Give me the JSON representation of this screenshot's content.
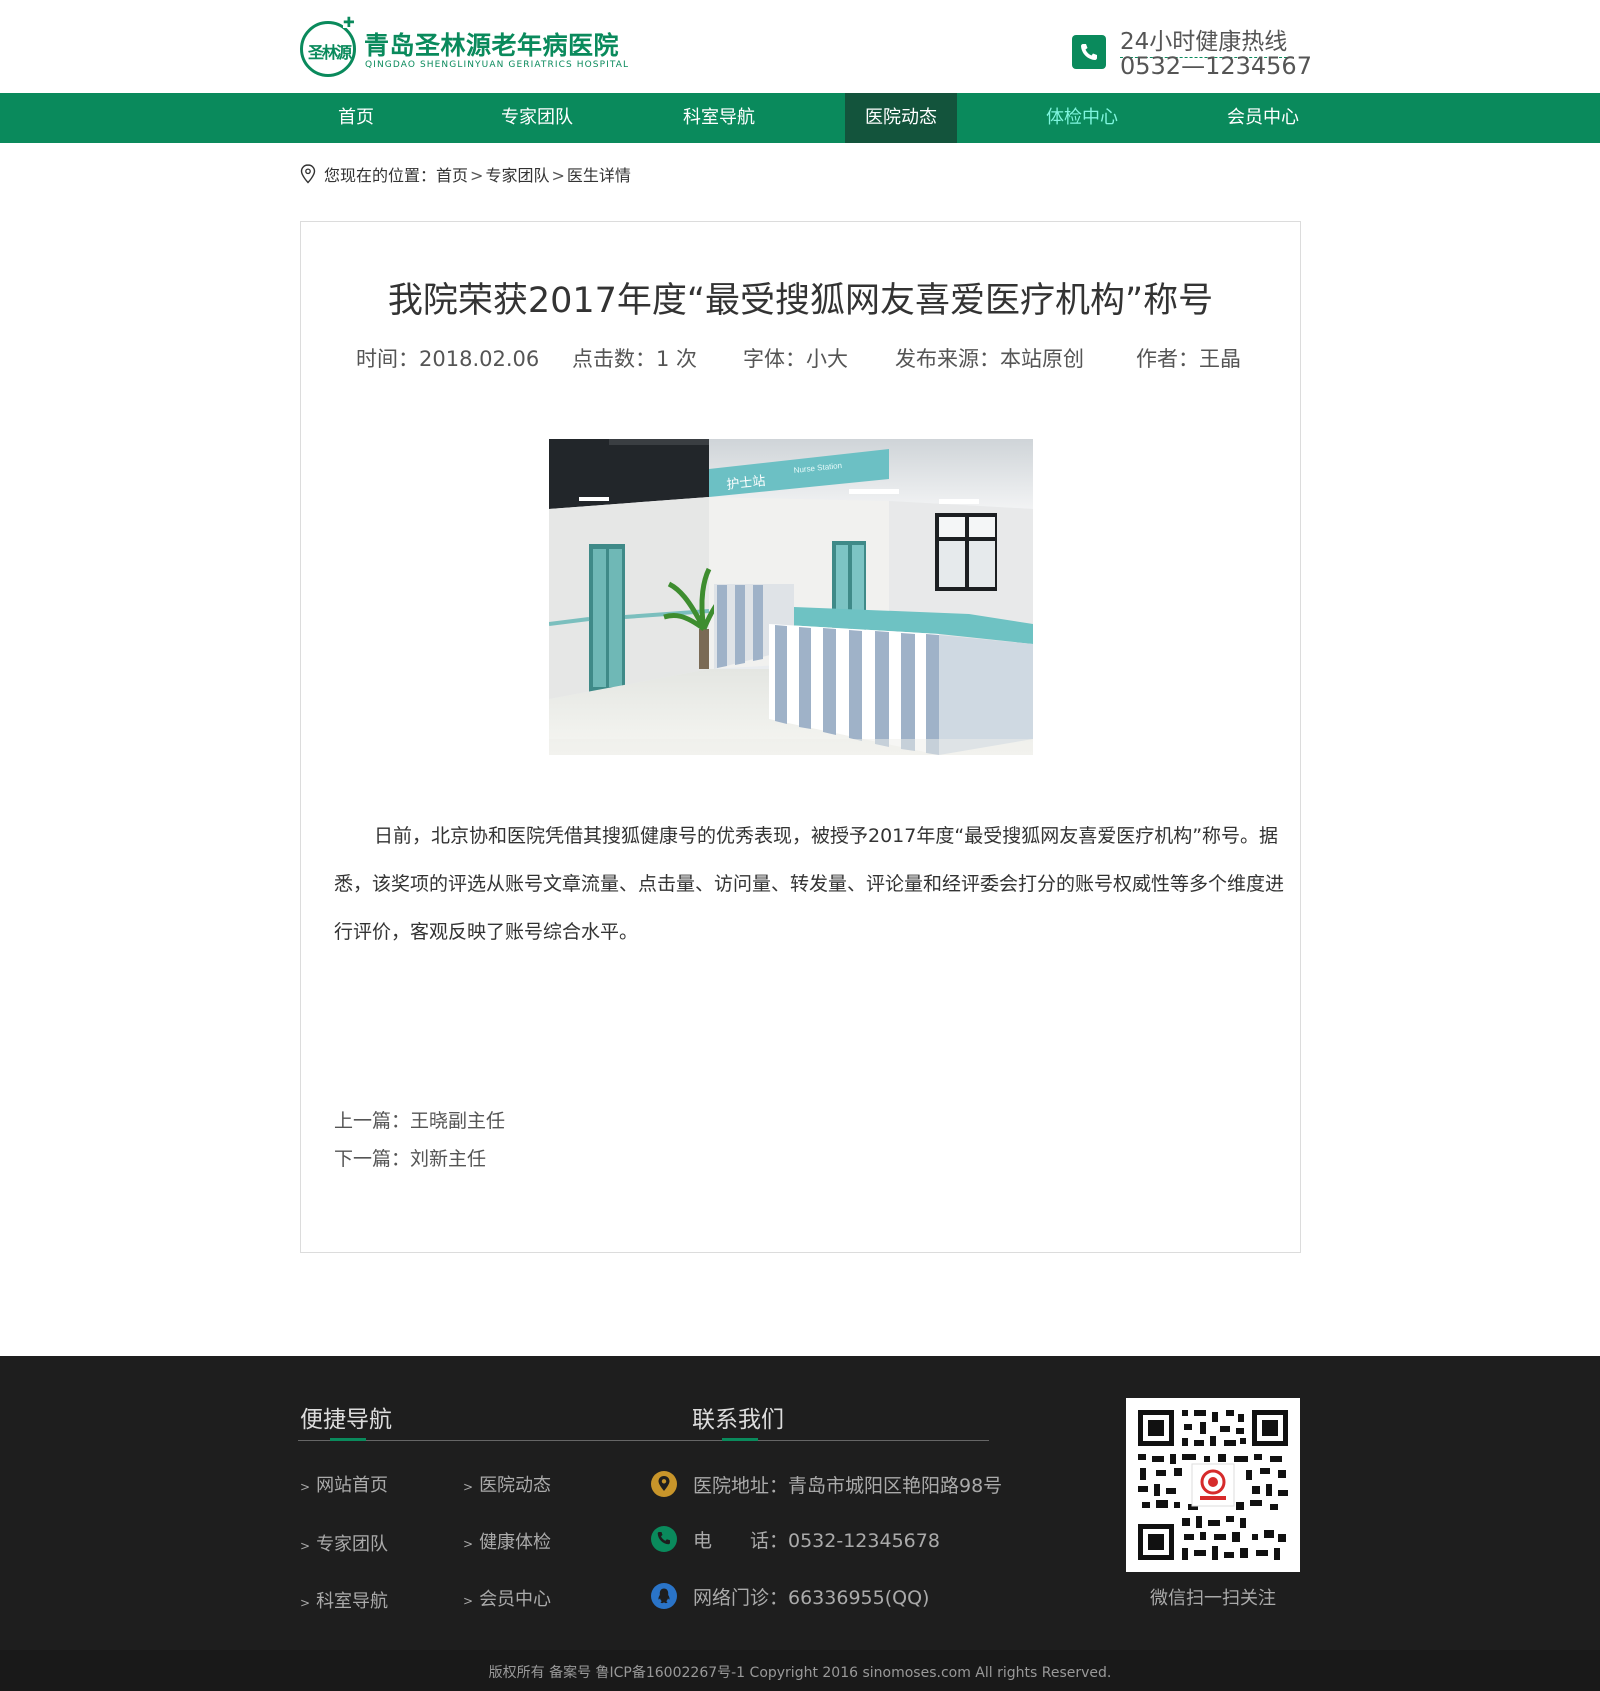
{
  "header": {
    "logo_badge_text": "圣林源",
    "logo_cn": "青岛圣林源老年病医院",
    "logo_en": "QINGDAO SHENGLINYUAN GERIATRICS HOSPITAL",
    "hotline_label": "24小时健康热线",
    "hotline_number": "0532—1234567",
    "brand_color": "#0a8a5c"
  },
  "nav": {
    "items": [
      {
        "label": "首页"
      },
      {
        "label": "专家团队"
      },
      {
        "label": "科室导航"
      },
      {
        "label": "医院动态",
        "active": true
      },
      {
        "label": "体检中心",
        "highlight": true
      },
      {
        "label": "会员中心"
      }
    ],
    "bg_color": "#0a8a5c",
    "active_color": "#13543c"
  },
  "breadcrumb": {
    "prefix": "您现在的位置：",
    "items": [
      "首页",
      "专家团队",
      "医生详情"
    ],
    "separator": ">"
  },
  "article": {
    "title": "我院荣获2017年度“最受搜狐网友喜爱医疗机构”称号",
    "meta": {
      "time": "时间：2018.02.06",
      "clicks": "点击数：1 次",
      "font": "字体：小大",
      "source": "发布来源：本站原创",
      "author": "作者：王晶"
    },
    "image_label": "护士站",
    "image_label_en": "Nurse Station",
    "body": "日前，北京协和医院凭借其搜狐健康号的优秀表现，被授予2017年度“最受搜狐网友喜爱医疗机构”称号。据悉，该奖项的评选从账号文章流量、点击量、访问量、转发量、评论量和经评委会打分的账号权威性等多个维度进行评价，客观反映了账号综合水平。",
    "prev": "上一篇：王晓副主任",
    "next": "下一篇：刘新主任"
  },
  "footer": {
    "nav_title": "便捷导航",
    "contact_title": "联系我们",
    "links": [
      "网站首页",
      "医院动态",
      "专家团队",
      "健康体检",
      "科室导航",
      "会员中心"
    ],
    "link_arrow": ">",
    "contacts": {
      "address": "医院地址：青岛市城阳区艳阳路98号",
      "phone": "电　　话：0532-12345678",
      "online": "网络门诊：66336955(QQ)"
    },
    "contact_icon_colors": [
      "#c8952a",
      "#0a8a5c",
      "#2a74c8"
    ],
    "qr_caption": "微信扫一扫关注",
    "copyright": "版权所有 备案号 鲁ICP备16002267号-1 Copyright 2016 sinomoses.com All rights Reserved."
  }
}
